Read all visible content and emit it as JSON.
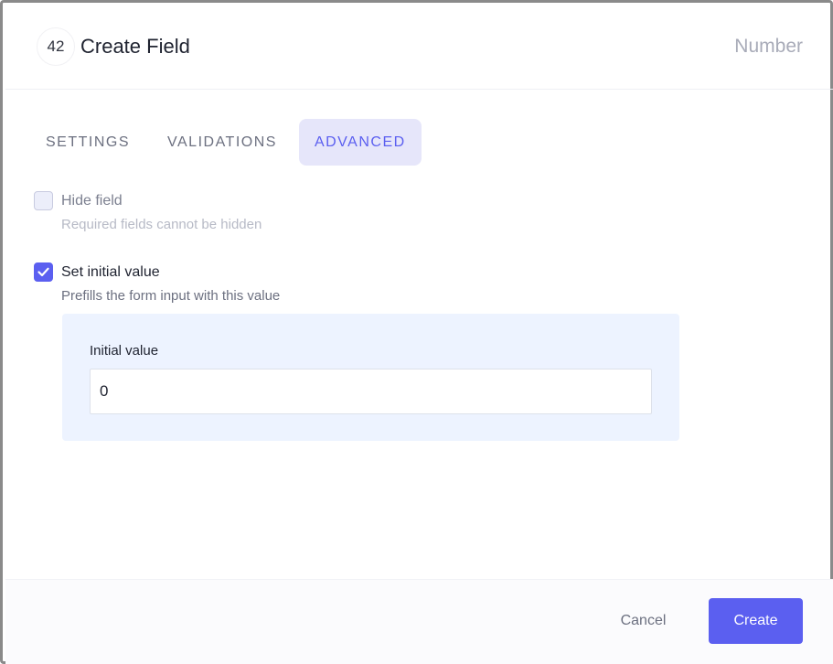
{
  "header": {
    "type_badge": "42",
    "title": "Create Field",
    "field_type": "Number"
  },
  "tabs": [
    {
      "label": "SETTINGS",
      "active": false
    },
    {
      "label": "VALIDATIONS",
      "active": false
    },
    {
      "label": "ADVANCED",
      "active": true
    }
  ],
  "options": {
    "hide_field": {
      "label": "Hide field",
      "description": "Required fields cannot be hidden",
      "checked": false,
      "disabled": true
    },
    "set_initial_value": {
      "label": "Set initial value",
      "description": "Prefills the form input with this value",
      "checked": true
    }
  },
  "initial_value_panel": {
    "label": "Initial value",
    "value": "0"
  },
  "footer": {
    "cancel_label": "Cancel",
    "create_label": "Create"
  },
  "colors": {
    "accent": "#5b5ff0",
    "tab_active_bg": "#e6e6fa",
    "panel_bg": "#edf3ff"
  }
}
